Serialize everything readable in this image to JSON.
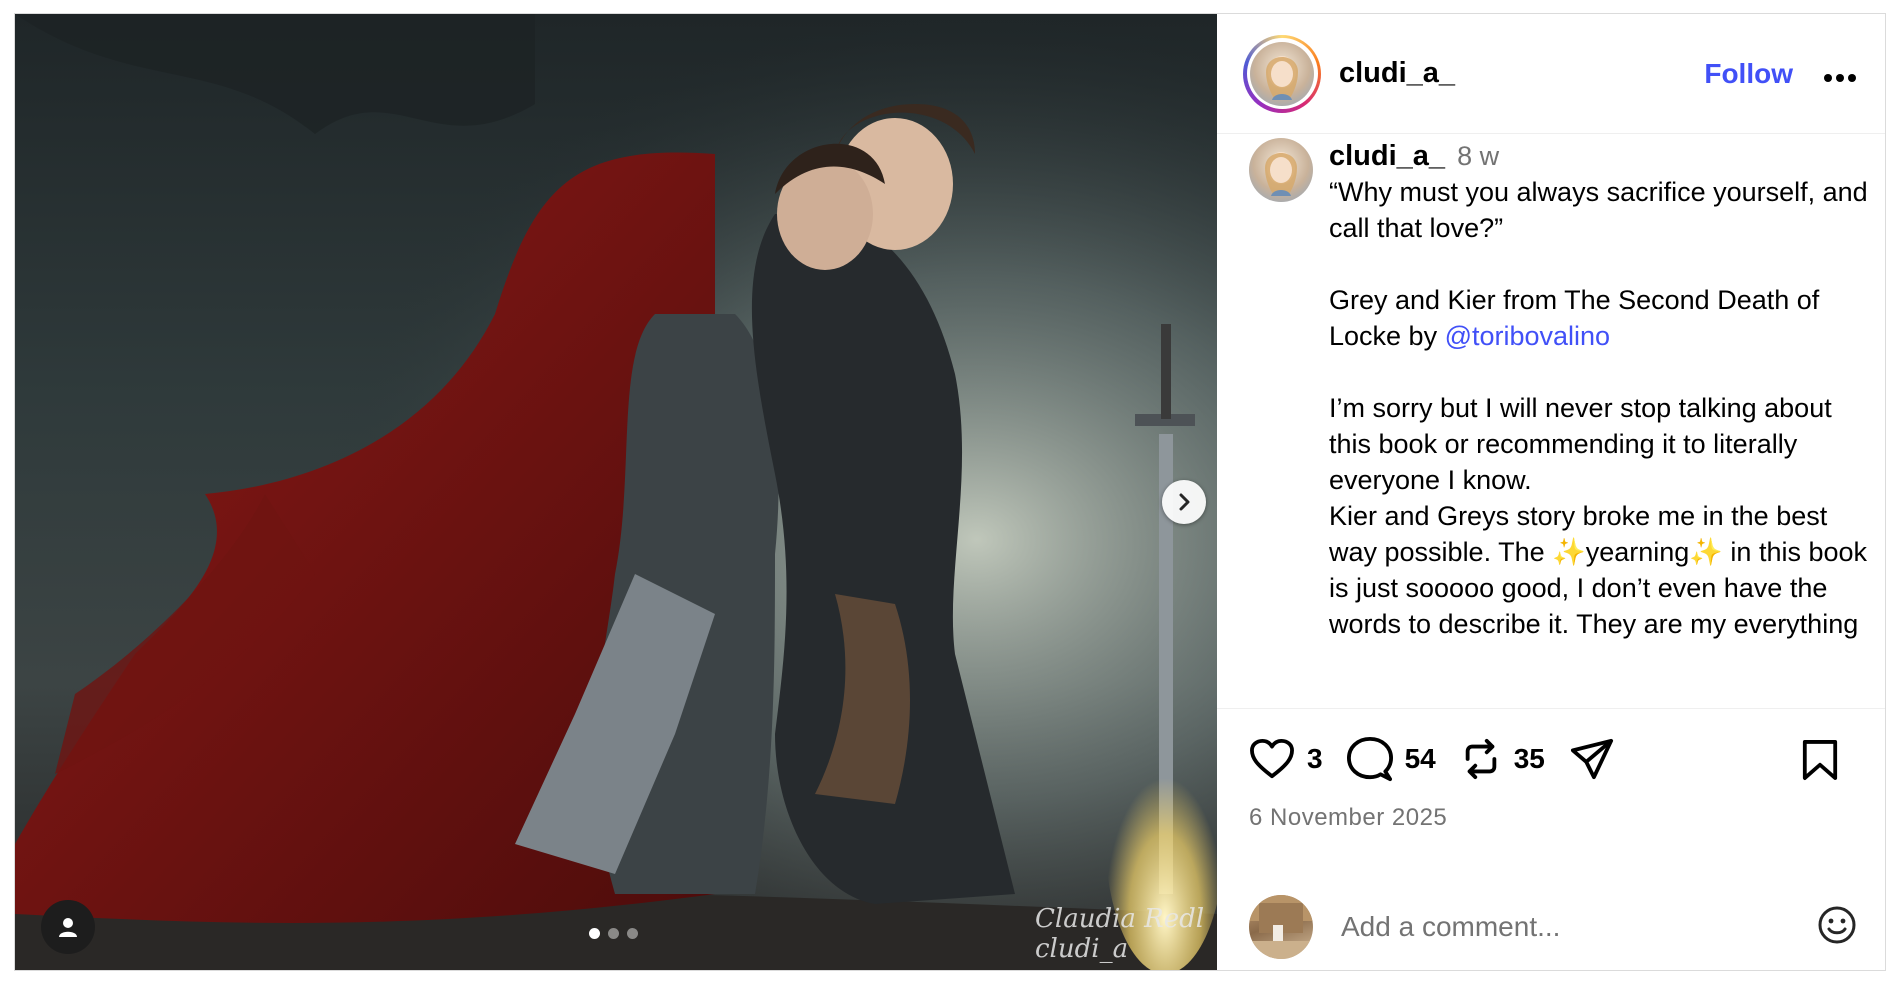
{
  "post": {
    "author": "cludi_a_",
    "follow_label": "Follow",
    "more_label": "•••",
    "media_signature": "Claudia Redl cludi_a",
    "carousel": {
      "total": 3,
      "active": 1
    }
  },
  "caption": {
    "username": "cludi_a_",
    "time": "8 w",
    "line1": "“Why must you always sacrifice yourself, and call that love?”",
    "line2_prefix": "Grey and Kier from The Second Death of Locke by ",
    "mention": "@toribovalino",
    "line3": "I’m sorry but I will never stop talking about this book or recommending it to literally everyone I know.",
    "line4": "Kier and Greys story broke me in the best way possible. The ✨yearning✨ in this book is just sooooo good, I don’t even have the words to describe it. They are my everything"
  },
  "actions": {
    "likes": "3",
    "comments": "54",
    "reposts": "35"
  },
  "date": "6 November 2025",
  "comment_box": {
    "placeholder": "Add a comment..."
  },
  "icons": [
    "more-icon",
    "heart-icon",
    "comment-icon",
    "repost-icon",
    "share-icon",
    "save-icon",
    "emoji-icon",
    "chevron-right-icon",
    "user-tag-icon"
  ],
  "colors": {
    "accent": "#4150f7",
    "muted": "#737373",
    "border": "#dbdbdb"
  }
}
